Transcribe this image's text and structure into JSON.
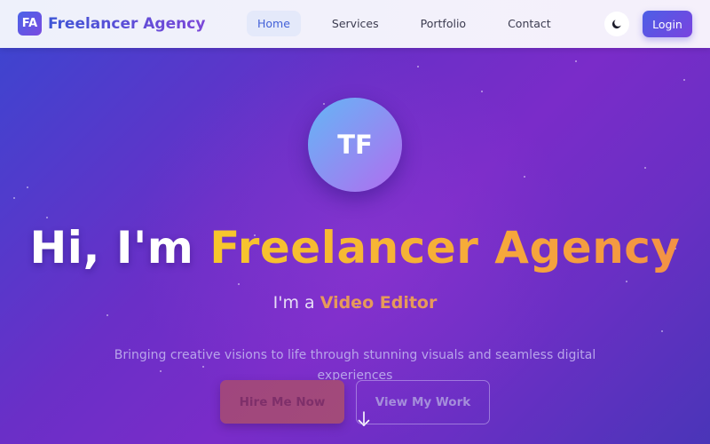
{
  "navbar": {
    "brand_logo": "FA",
    "brand_name": "Freelancer Agency",
    "links": [
      "Home",
      "Services",
      "Portfolio",
      "Contact"
    ],
    "active_link": "Home",
    "theme_icon": "moon-icon",
    "login_label": "Login"
  },
  "hero": {
    "avatar_initials": "TF",
    "title_prefix": "Hi, I'm ",
    "title_name": "Freelancer Agency",
    "subtitle_prefix": "I'm a ",
    "subtitle_role": "Video Editor",
    "description": "Bringing creative visions to life through stunning visuals and seamless digital experiences",
    "scroll_icon": "arrow-down-icon",
    "primary_button": "Hire Me Now",
    "secondary_button": "View My Work"
  },
  "colors": {
    "brand_accent": "#4a63e8",
    "hero_gradient_start": "#3f44cf",
    "hero_gradient_mid": "#7a2cc9",
    "title_accent": "#f7c72c",
    "role_accent": "#e79a59"
  }
}
